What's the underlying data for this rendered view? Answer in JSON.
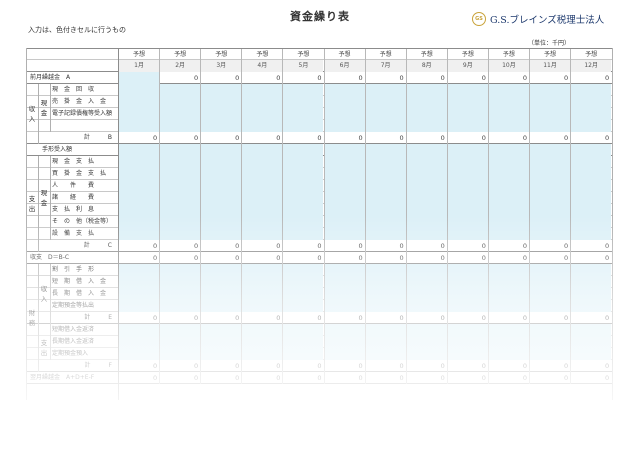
{
  "title": "資金繰り表",
  "note": "入力は、色付きセルに行うもの",
  "logo": {
    "mark": "GS",
    "text": "G.S.ブレインズ税理士法人"
  },
  "unit": "（単位：千円）",
  "colors": {
    "input_fill": "#dcf0f7",
    "logo_gold": "#c9a33a",
    "logo_navy": "#1e3a6e"
  },
  "header_row": [
    "予想",
    "予想",
    "予想",
    "予想",
    "予想",
    "予想",
    "予想",
    "予想",
    "予想",
    "予想",
    "予想",
    "予想"
  ],
  "months": [
    "1月",
    "2月",
    "3月",
    "4月",
    "5月",
    "6月",
    "7月",
    "8月",
    "9月",
    "10月",
    "11月",
    "12月"
  ],
  "groups": {
    "income": "収入",
    "income_cash": "現金",
    "expense": "支出",
    "expense_cash": "現金",
    "finance": "財務",
    "fin_income": "収入",
    "fin_expense": "支出"
  },
  "rows": [
    {
      "label": "前月繰越金　A",
      "values": [
        "",
        "0",
        "0",
        "0",
        "0",
        "0",
        "0",
        "0",
        "0",
        "0",
        "0",
        "0"
      ]
    },
    {
      "label": "現　金　回　収",
      "values": []
    },
    {
      "label": "売　掛　金　入　金",
      "values": []
    },
    {
      "label": "電子記録債権等受入額",
      "values": []
    },
    {
      "label": "",
      "values": []
    },
    {
      "label": "計　　　B",
      "values": [
        "0",
        "0",
        "0",
        "0",
        "0",
        "0",
        "0",
        "0",
        "0",
        "0",
        "0",
        "0"
      ]
    },
    {
      "label": "手形受入額",
      "values": []
    },
    {
      "label": "現　金　支　払",
      "values": []
    },
    {
      "label": "買　掛　金　支　払",
      "values": []
    },
    {
      "label": "人　　件　　費",
      "values": []
    },
    {
      "label": "諸　　経　　費",
      "values": []
    },
    {
      "label": "支　払　利　息",
      "values": []
    },
    {
      "label": "そ　の　他（税金等）",
      "values": []
    },
    {
      "label": "設　備　支　払",
      "values": []
    },
    {
      "label": "計　　　C",
      "values": [
        "0",
        "0",
        "0",
        "0",
        "0",
        "0",
        "0",
        "0",
        "0",
        "0",
        "0",
        "0"
      ]
    },
    {
      "label": "収支　D＝B-C",
      "values": [
        "0",
        "0",
        "0",
        "0",
        "0",
        "0",
        "0",
        "0",
        "0",
        "0",
        "0",
        "0"
      ]
    },
    {
      "label": "割　引　手　形",
      "values": []
    },
    {
      "label": "短　期　借　入　金",
      "values": []
    },
    {
      "label": "長　期　借　入　金",
      "values": []
    },
    {
      "label": "定期預金等払出",
      "values": []
    },
    {
      "label": "計　　　E",
      "values": [
        "0",
        "0",
        "0",
        "0",
        "0",
        "0",
        "0",
        "0",
        "0",
        "0",
        "0",
        "0"
      ]
    },
    {
      "label": "短期借入金返済",
      "values": []
    },
    {
      "label": "長期借入金返済",
      "values": []
    },
    {
      "label": "定期預金預入",
      "values": []
    },
    {
      "label": "計　　　F",
      "values": [
        "0",
        "0",
        "0",
        "0",
        "0",
        "0",
        "0",
        "0",
        "0",
        "0",
        "0",
        "0"
      ]
    },
    {
      "label": "翌月繰越金　A+D+E-F",
      "values": [
        "0",
        "0",
        "0",
        "0",
        "0",
        "0",
        "0",
        "0",
        "0",
        "0",
        "0",
        "0"
      ]
    }
  ]
}
